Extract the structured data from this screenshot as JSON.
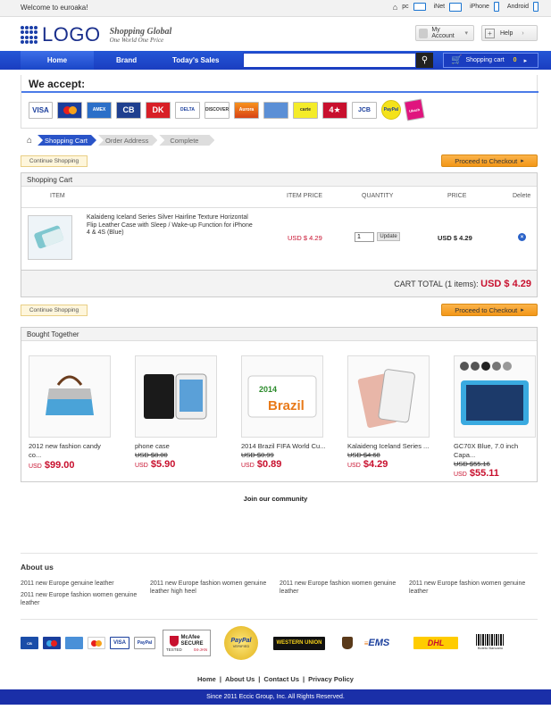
{
  "topbar": {
    "welcome": "Welcome to euroaka!",
    "devices": [
      "pc",
      "iNet",
      "iPhone",
      "Android"
    ]
  },
  "header": {
    "logo_text": "LOGO",
    "tagline_main": "Shopping Global",
    "tagline_sub": "One World One Price",
    "account_label": "My Account",
    "help_label": "Help"
  },
  "nav": {
    "items": [
      "Home",
      "Brand",
      "Today's Sales"
    ],
    "search_placeholder": "",
    "cart_label": "Shopping cart",
    "cart_count": "0"
  },
  "accept": {
    "title": "We accept:",
    "methods": [
      "VISA",
      "MC",
      "AMEX",
      "CB",
      "DK",
      "DELTA",
      "DISCOVER",
      "Aurora",
      "Maestro",
      "carte",
      "4★",
      "JCB",
      "PayPal",
      "Ukash"
    ]
  },
  "steps": [
    "Shopping Cart",
    "Order Address",
    "Complete"
  ],
  "buttons": {
    "continue": "Continue Shopping",
    "checkout": "Proceed to Checkout"
  },
  "cart": {
    "title": "Shopping Cart",
    "columns": [
      "ITEM",
      "ITEM PRICE",
      "QUANTITY",
      "PRICE",
      "Delete"
    ],
    "item": {
      "title": "Kalaideng Iceland Series Silver Hairline Texture Horizontal Flip Leather Case with Sleep / Wake-up Function for iPhone 4 & 4S (Blue)",
      "item_price": "USD $ 4.29",
      "quantity": "1",
      "update_label": "Update",
      "price": "USD $ 4.29"
    },
    "total_label": "CART TOTAL (1 items):",
    "total_amount": "USD $ 4.29"
  },
  "bought": {
    "title": "Bought Together",
    "products": [
      {
        "name": "2012 new fashion candy co...",
        "old": "",
        "currency": "USD",
        "price": "$99.00"
      },
      {
        "name": "phone case",
        "old": "USD $8.00",
        "currency": "USD",
        "price": "$5.90"
      },
      {
        "name": "2014 Brazil FIFA World Cu...",
        "old": "USD $0.99",
        "currency": "USD",
        "price": "$0.89"
      },
      {
        "name": "Kalaideng Iceland Series ...",
        "old": "USD $4.68",
        "currency": "USD",
        "price": "$4.29"
      },
      {
        "name": "GC70X Blue, 7.0 inch Capa...",
        "old": "USD $55.16",
        "currency": "USD",
        "price": "$55.11"
      }
    ]
  },
  "community": {
    "title": "Join our community"
  },
  "about": {
    "title": "About us",
    "links": [
      "2011 new Europe genuine leather",
      "2011 new Europe fashion women genuine leather high heel",
      "2011 new Europe fashion women genuine leather",
      "2011 new Europe fashion women genuine leather",
      "2011 new Europe fashion women genuine leather"
    ]
  },
  "trust": {
    "mcafee_line1": "McAfee",
    "mcafee_line2": "SECURE",
    "mcafee_tested": "TESTED",
    "mcafee_date": "04-JAN",
    "paypal": "PayPal",
    "paypal_sub": "VERIFIED",
    "western_union": "WESTERN UNION",
    "ems": "EMS",
    "dhl": "DHL",
    "boleto": "Boleto Bancario"
  },
  "footer": {
    "links": [
      "Home",
      "About Us",
      "Contact Us",
      "Privacy Policy"
    ],
    "copyright": "Since 2011 Eccic Group, Inc. All Rights Reserved."
  }
}
